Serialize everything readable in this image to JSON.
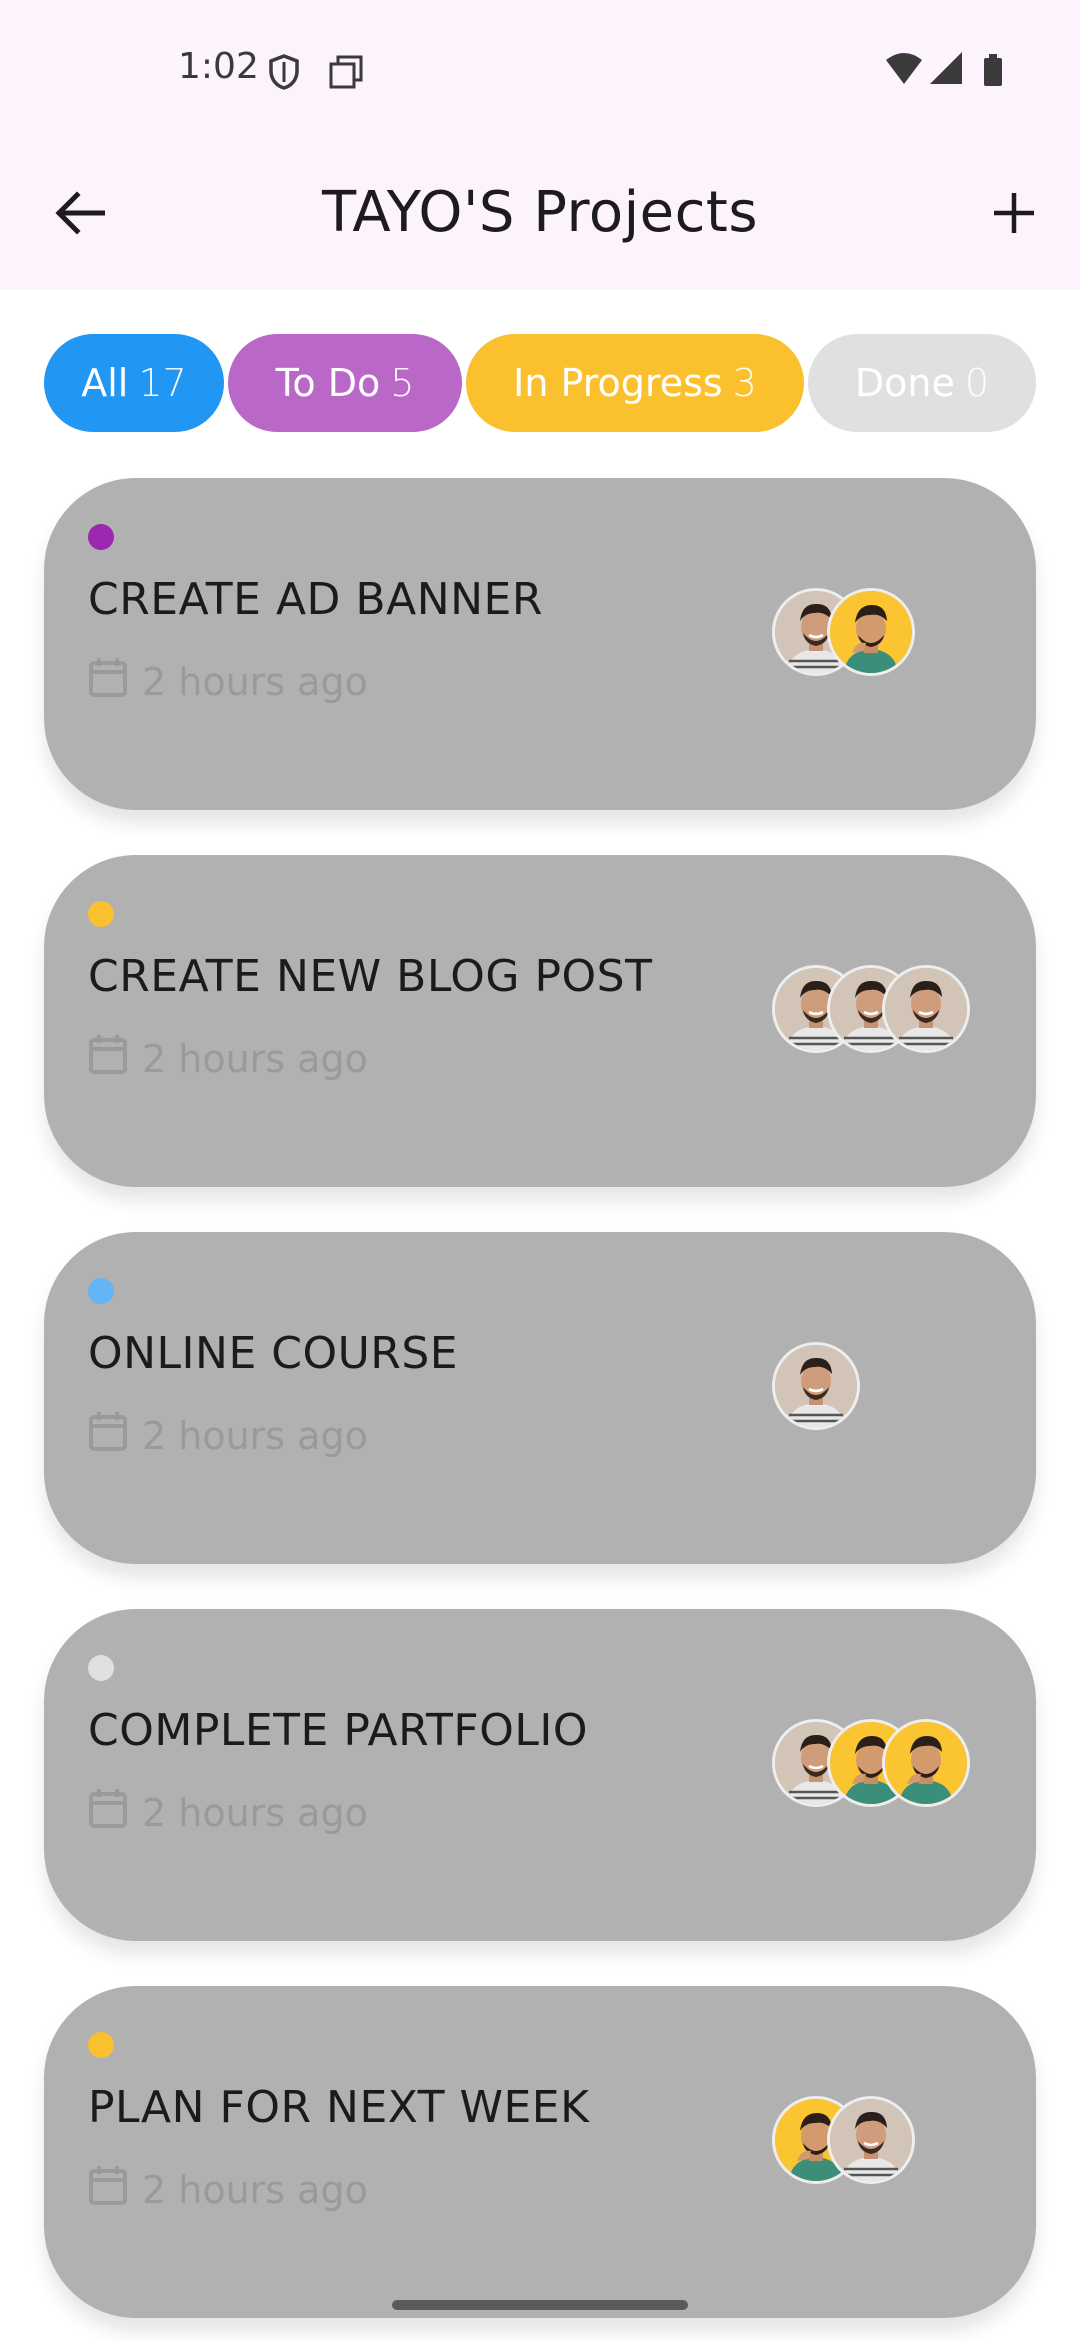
{
  "status_bar": {
    "time": "1:02"
  },
  "app_bar": {
    "title": "TAYO'S Projects",
    "back_icon": "arrow-left-icon",
    "add_icon": "plus-icon"
  },
  "filters": [
    {
      "label": "All",
      "count": "17",
      "color": "#2196f3"
    },
    {
      "label": "To Do",
      "count": "5",
      "color": "#ba68c8"
    },
    {
      "label": "In Progress",
      "count": "3",
      "color": "#fbc02d"
    },
    {
      "label": "Done",
      "count": "0",
      "color": "#e0e0e0"
    }
  ],
  "projects": [
    {
      "title": "CREATE AD BANNER",
      "time": "2 hours ago",
      "status_color": "#9c27b0",
      "avatars": [
        "neutral",
        "yellow"
      ]
    },
    {
      "title": "CREATE NEW BLOG POST",
      "time": "2 hours ago",
      "status_color": "#fbc02d",
      "avatars": [
        "neutral",
        "neutral",
        "neutral"
      ]
    },
    {
      "title": "ONLINE COURSE",
      "time": "2 hours ago",
      "status_color": "#64b5f6",
      "avatars": [
        "neutral"
      ]
    },
    {
      "title": "COMPLETE PARTFOLIO",
      "time": "2 hours ago",
      "status_color": "#e0e0e0",
      "avatars": [
        "neutral",
        "yellow",
        "yellow"
      ]
    },
    {
      "title": "PLAN FOR NEXT WEEK",
      "time": "2 hours ago",
      "status_color": "#fbc02d",
      "avatars": [
        "yellow",
        "neutral"
      ]
    }
  ]
}
